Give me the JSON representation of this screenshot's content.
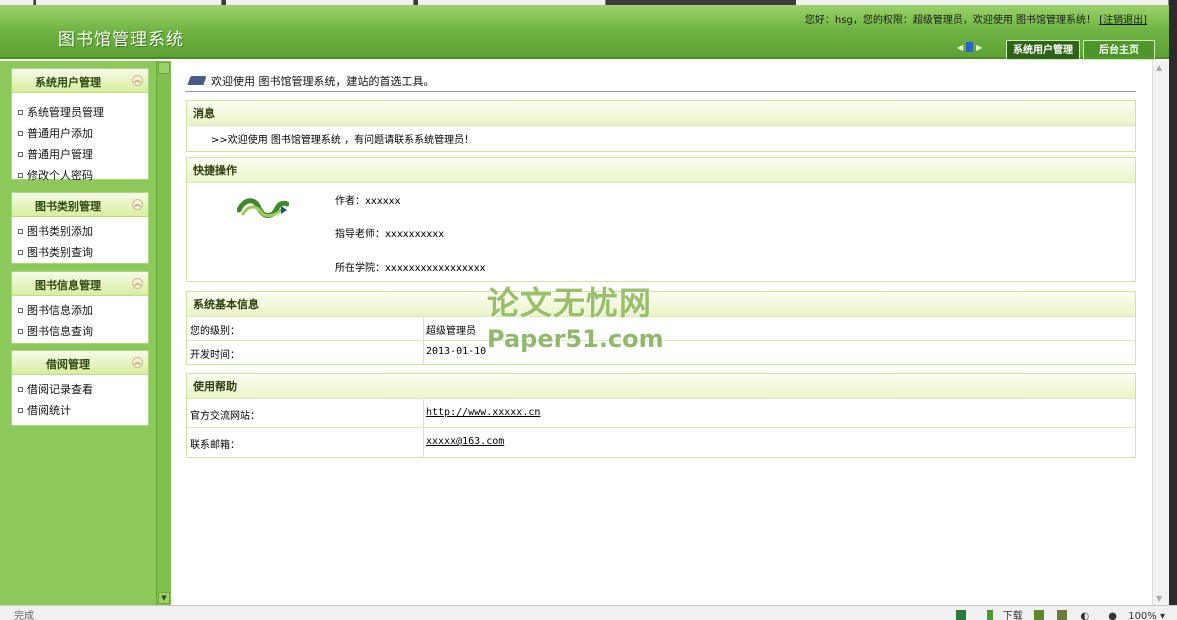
{
  "header": {
    "app_title": "图书馆管理系统",
    "user_info_prefix": "您好：hsg，您的权限：超级管理员，欢迎使用 图书馆管理系统！",
    "logout_label": "[注销退出]",
    "tab_user_mgmt": "系统用户管理",
    "tab_home": "后台主页"
  },
  "sidebar": {
    "menus": [
      {
        "title": "系统用户管理",
        "items": [
          "系统管理员管理",
          "普通用户添加",
          "普通用户管理",
          "修改个人密码"
        ]
      },
      {
        "title": "图书类别管理",
        "items": [
          "图书类别添加",
          "图书类别查询"
        ]
      },
      {
        "title": "图书信息管理",
        "items": [
          "图书信息添加",
          "图书信息查询"
        ]
      },
      {
        "title": "借阅管理",
        "items": [
          "借阅记录查看",
          "借阅统计"
        ]
      }
    ]
  },
  "main": {
    "welcome": "欢迎使用 图书馆管理系统，建站的首选工具。",
    "message_panel": {
      "title": "消息",
      "text": ">>欢迎使用 图书馆管理系统 ，有问题请联系系统管理员！"
    },
    "quick_panel": {
      "title": "快捷操作",
      "author": "作者：xxxxxx",
      "teacher": "指导老师：xxxxxxxxxx",
      "college": "所在学院：xxxxxxxxxxxxxxxxx"
    },
    "sys_panel": {
      "title": "系统基本信息",
      "rows": [
        {
          "k": "您的级别：",
          "v": "超级管理员"
        },
        {
          "k": "开发时间：",
          "v": "2013-01-10"
        }
      ]
    },
    "help_panel": {
      "title": "使用帮助",
      "rows": [
        {
          "k": "官方交流网站：",
          "v": "http://www.xxxxx.cn"
        },
        {
          "k": "联系邮箱：",
          "v": "xxxxx@163.com"
        }
      ]
    },
    "watermark_line1": "论文无忧网",
    "watermark_line2": "Paper51.com"
  },
  "statusbar": {
    "status": "完成",
    "download": "下载",
    "zoom": "100%"
  }
}
